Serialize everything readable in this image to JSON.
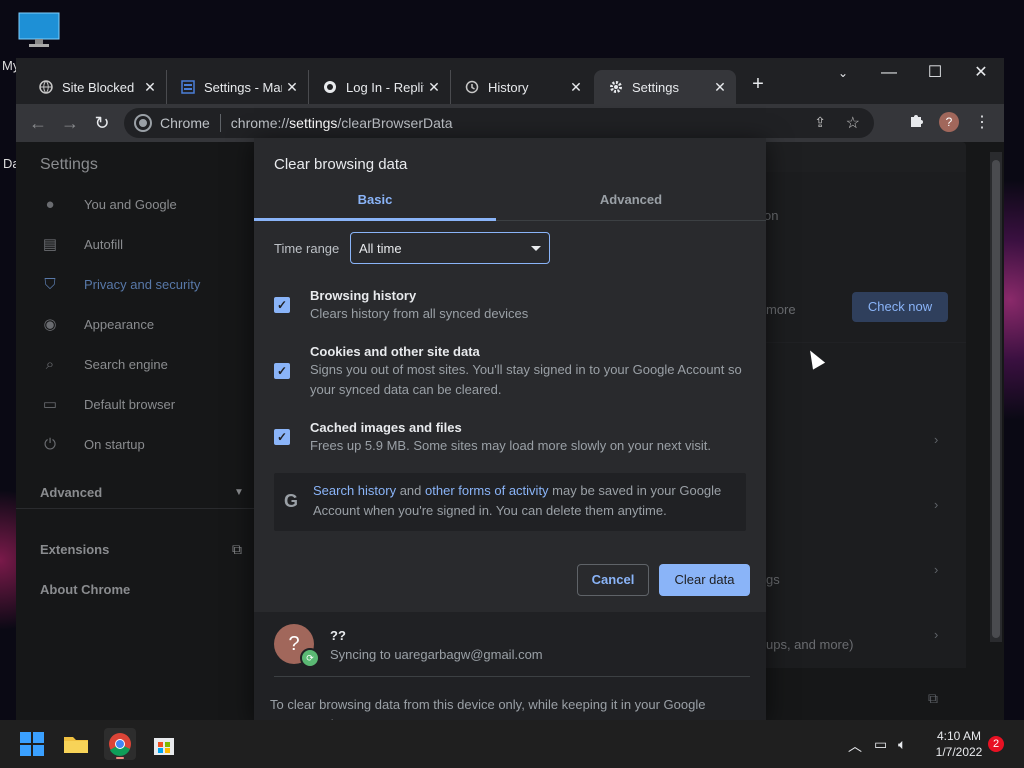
{
  "desktop": {
    "label_fragment_1": "My",
    "label_fragment_2": "Da"
  },
  "tabs": [
    {
      "title": "Site Blocked",
      "icon": "globe-icon"
    },
    {
      "title": "Settings - Mar",
      "icon": "settings-page-icon"
    },
    {
      "title": "Log In - Replit",
      "icon": "replit-icon"
    },
    {
      "title": "History",
      "icon": "history-icon"
    },
    {
      "title": "Settings",
      "icon": "gear-icon",
      "active": true
    }
  ],
  "omnibox": {
    "scheme_label": "Chrome",
    "url_prefix": "chrome://",
    "url_host": "settings",
    "url_path": "/clearBrowserData"
  },
  "settings_page": {
    "header": "Settings",
    "sidebar": [
      {
        "label": "You and Google",
        "icon": "person-icon"
      },
      {
        "label": "Autofill",
        "icon": "clipboard-icon"
      },
      {
        "label": "Privacy and security",
        "icon": "shield-icon",
        "active": true
      },
      {
        "label": "Appearance",
        "icon": "palette-icon"
      },
      {
        "label": "Search engine",
        "icon": "search-icon"
      },
      {
        "label": "Default browser",
        "icon": "browser-icon"
      },
      {
        "label": "On startup",
        "icon": "power-icon"
      }
    ],
    "advanced_label": "Advanced",
    "extensions_label": "Extensions",
    "about_label": "About Chrome",
    "bg_fragment_on": "on",
    "bg_fragment_more": "more",
    "check_now_label": "Check now",
    "bg_fragment_gs": "gs",
    "bg_fragment_ups": "ups, and more)"
  },
  "dialog": {
    "title": "Clear browsing data",
    "tab_basic": "Basic",
    "tab_advanced": "Advanced",
    "time_range_label": "Time range",
    "time_range_value": "All time",
    "items": [
      {
        "title": "Browsing history",
        "desc": "Clears history from all synced devices",
        "checked": true
      },
      {
        "title": "Cookies and other site data",
        "desc": "Signs you out of most sites. You'll stay signed in to your Google Account so your synced data can be cleared.",
        "checked": true
      },
      {
        "title": "Cached images and files",
        "desc": "Frees up 5.9 MB. Some sites may load more slowly on your next visit.",
        "checked": true
      }
    ],
    "info_link_1": "Search history",
    "info_and": " and ",
    "info_link_2": "other forms of activity",
    "info_rest": " may be saved in your Google Account when you're signed in. You can delete them anytime.",
    "cancel_label": "Cancel",
    "clear_label": "Clear data",
    "profile_name": "??",
    "profile_sync": "Syncing to uaregarbagw@gmail.com",
    "footer_note": "To clear browsing data from this device only, while keeping it in your Google Account, sign out."
  },
  "taskbar": {
    "time": "4:10 AM",
    "date": "1/7/2022",
    "notification_count": "2"
  },
  "colors": {
    "accent": "#8ab4f8",
    "dialog_bg": "#292a2d",
    "frame_bg": "#202124"
  }
}
